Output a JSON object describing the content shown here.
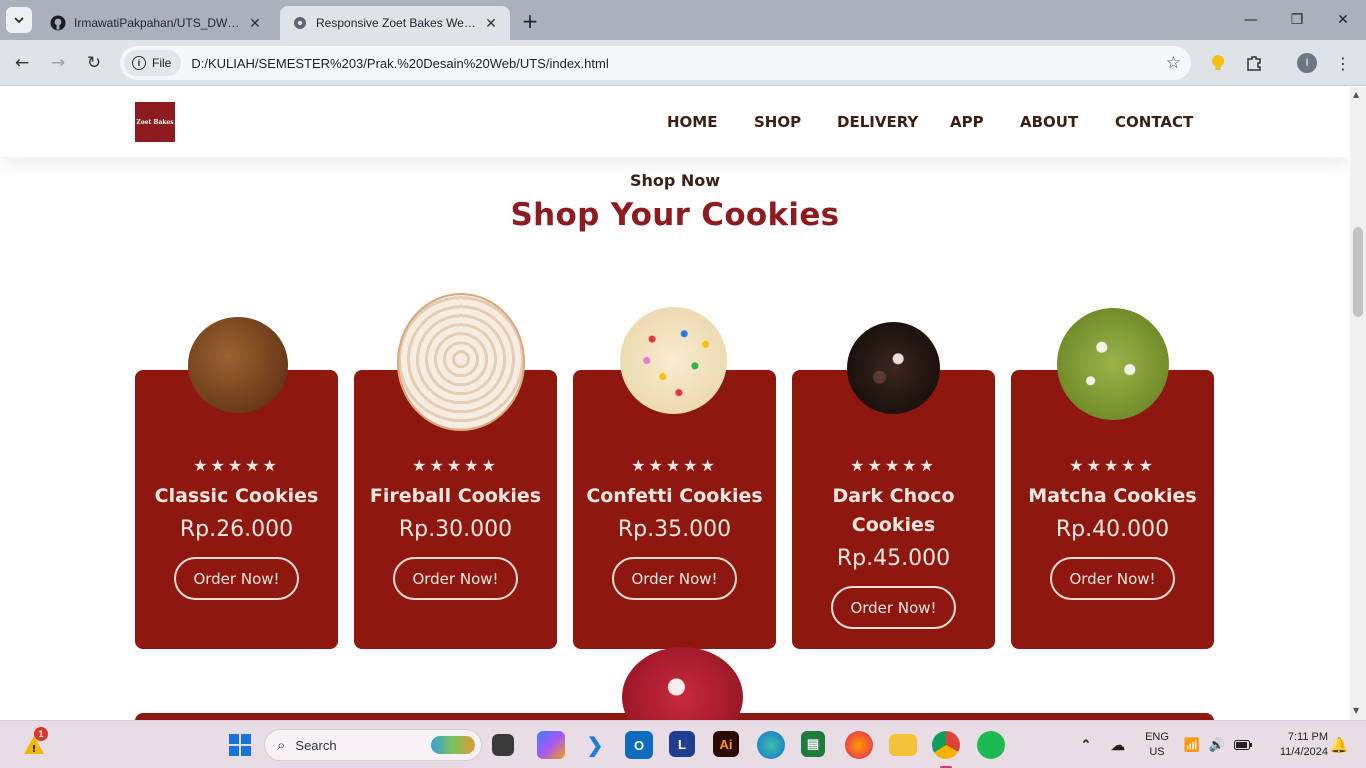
{
  "browser": {
    "tabs": [
      {
        "title": "IrmawatiPakpahan/UTS_DW_Irm",
        "favicon": "github-icon",
        "active": false
      },
      {
        "title": "Responsive Zoet Bakes Website",
        "favicon": "globe-icon",
        "active": true
      }
    ],
    "chip_label": "File",
    "url": "D:/KULIAH/SEMESTER%203/Prak.%20Desain%20Web/UTS/index.html",
    "profile_initial": "I"
  },
  "site": {
    "logo_text": "Zoet Bakes",
    "nav": [
      "HOME",
      "SHOP",
      "DELIVERY",
      "APP",
      "ABOUT",
      "CONTACT"
    ],
    "kicker": "Shop Now",
    "title": "Shop Your Cookies",
    "products": [
      {
        "name": "Classic Cookies",
        "price": "Rp.26.000",
        "button": "Order Now!",
        "rating": 5,
        "cookie_color": "#7a4a22"
      },
      {
        "name": "Fireball Cookies",
        "price": "Rp.30.000",
        "button": "Order Now!",
        "rating": 5,
        "cookie_color": "#f0dcc4"
      },
      {
        "name": "Confetti Cookies",
        "price": "Rp.35.000",
        "button": "Order Now!",
        "rating": 5,
        "cookie_color": "#f3e7c8"
      },
      {
        "name": "Dark Choco Cookies",
        "price": "Rp.45.000",
        "button": "Order Now!",
        "rating": 5,
        "cookie_color": "#2a1a14"
      },
      {
        "name": "Matcha Cookies",
        "price": "Rp.40.000",
        "button": "Order Now!",
        "rating": 5,
        "cookie_color": "#8aa43a"
      }
    ],
    "accent_color": "#8e1710"
  },
  "taskbar": {
    "search_placeholder": "Search",
    "notification_count": "1",
    "language_line1": "ENG",
    "language_line2": "US",
    "time": "7:11 PM",
    "date": "11/4/2024"
  }
}
